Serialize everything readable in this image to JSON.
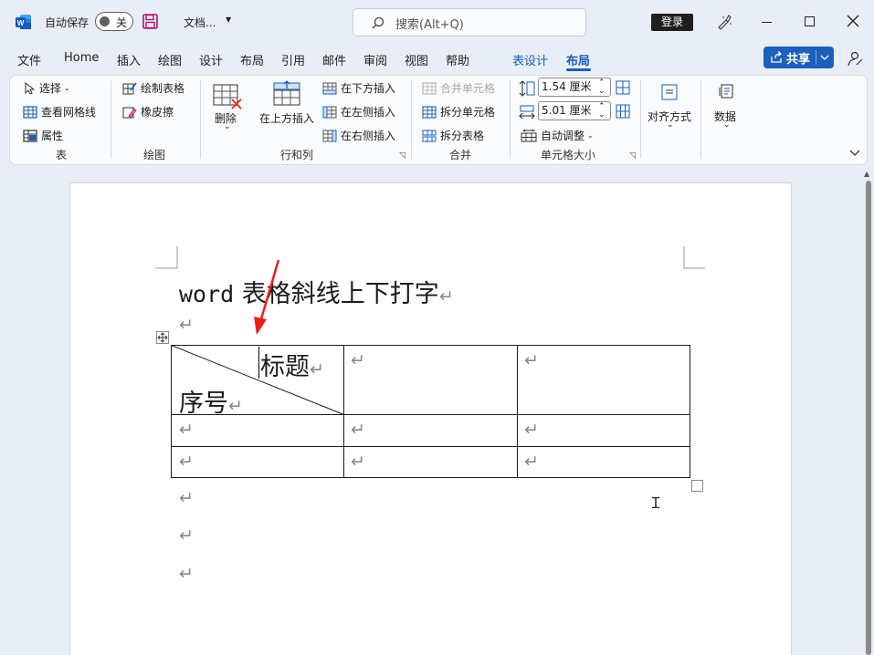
{
  "titlebar": {
    "autosave_label": "自动保存",
    "autosave_state": "关",
    "doc_name": "文档...",
    "search_placeholder": "搜索(Alt+Q)",
    "signin_label": "登录"
  },
  "menu": {
    "items": [
      "文件",
      "Home",
      "插入",
      "绘图",
      "设计",
      "布局",
      "引用",
      "邮件",
      "审阅",
      "视图",
      "帮助"
    ],
    "ctx_items": [
      "表设计",
      "布局"
    ],
    "share_label": "共享"
  },
  "ribbon": {
    "table_group": {
      "label": "表",
      "select": "选择",
      "gridlines": "查看网格线",
      "properties": "属性"
    },
    "draw_group": {
      "label": "绘图",
      "draw_table": "绘制表格",
      "eraser": "橡皮擦"
    },
    "rows_cols_group": {
      "label": "行和列",
      "delete": "删除",
      "insert_above": "在上方插入",
      "insert_below": "在下方插入",
      "insert_left": "在左侧插入",
      "insert_right": "在右侧插入"
    },
    "merge_group": {
      "label": "合并",
      "merge_cells": "合并单元格",
      "split_cells": "拆分单元格",
      "split_table": "拆分表格"
    },
    "cell_size_group": {
      "label": "单元格大小",
      "height_value": "1.54 厘米",
      "width_value": "5.01 厘米",
      "autofit": "自动调整"
    },
    "alignment": "对齐方式",
    "data": "数据"
  },
  "document": {
    "title_word": "word",
    "title_rest": " 表格斜线上下打字",
    "para_mark": "↵",
    "cell_header_top": "标题",
    "cell_header_bottom": "序号"
  },
  "colors": {
    "accent": "#1a5fb4",
    "share_bg": "#1e5fbd",
    "arrow": "#e8201a",
    "word_icon": "#185abd",
    "save_icon": "#b4146e"
  }
}
